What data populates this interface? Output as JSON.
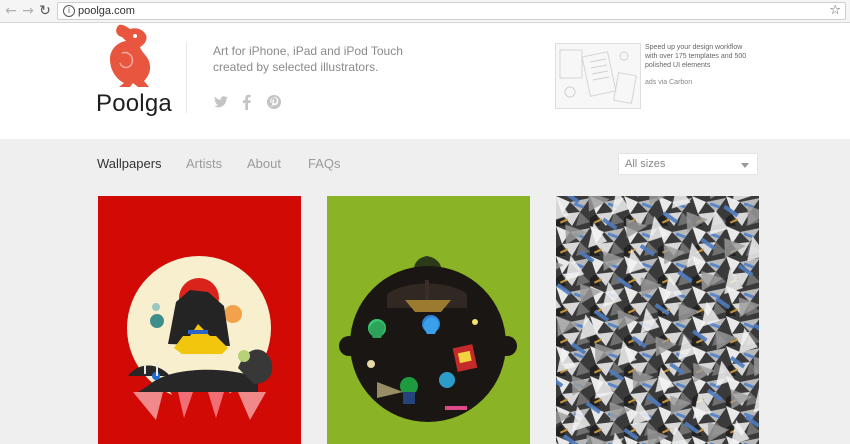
{
  "browser": {
    "url": "poolga.com",
    "icons": [
      "back-icon",
      "forward-icon",
      "reload-icon",
      "info-icon",
      "star-icon"
    ]
  },
  "header": {
    "brand": "Poolga",
    "tagline_line1": "Art for iPhone, iPad and iPod Touch",
    "tagline_line2": "created by selected illustrators.",
    "social": [
      "twitter-icon",
      "facebook-icon",
      "pinterest-icon"
    ],
    "ad": {
      "line1": "Speed up your design workflow",
      "line2": "with over 175 templates and 500",
      "line3": "polished UI elements",
      "via": "ads via Carbon"
    }
  },
  "nav": {
    "items": [
      "Wallpapers",
      "Artists",
      "About",
      "FAQs"
    ],
    "active": "Wallpapers"
  },
  "filter": {
    "selected": "All sizes"
  },
  "colors": {
    "brand": "#e8563f",
    "card1_bg": "#d10a06",
    "card2_bg": "#8ab326",
    "header_bg": "#ffffff",
    "page_bg": "#efefef"
  }
}
